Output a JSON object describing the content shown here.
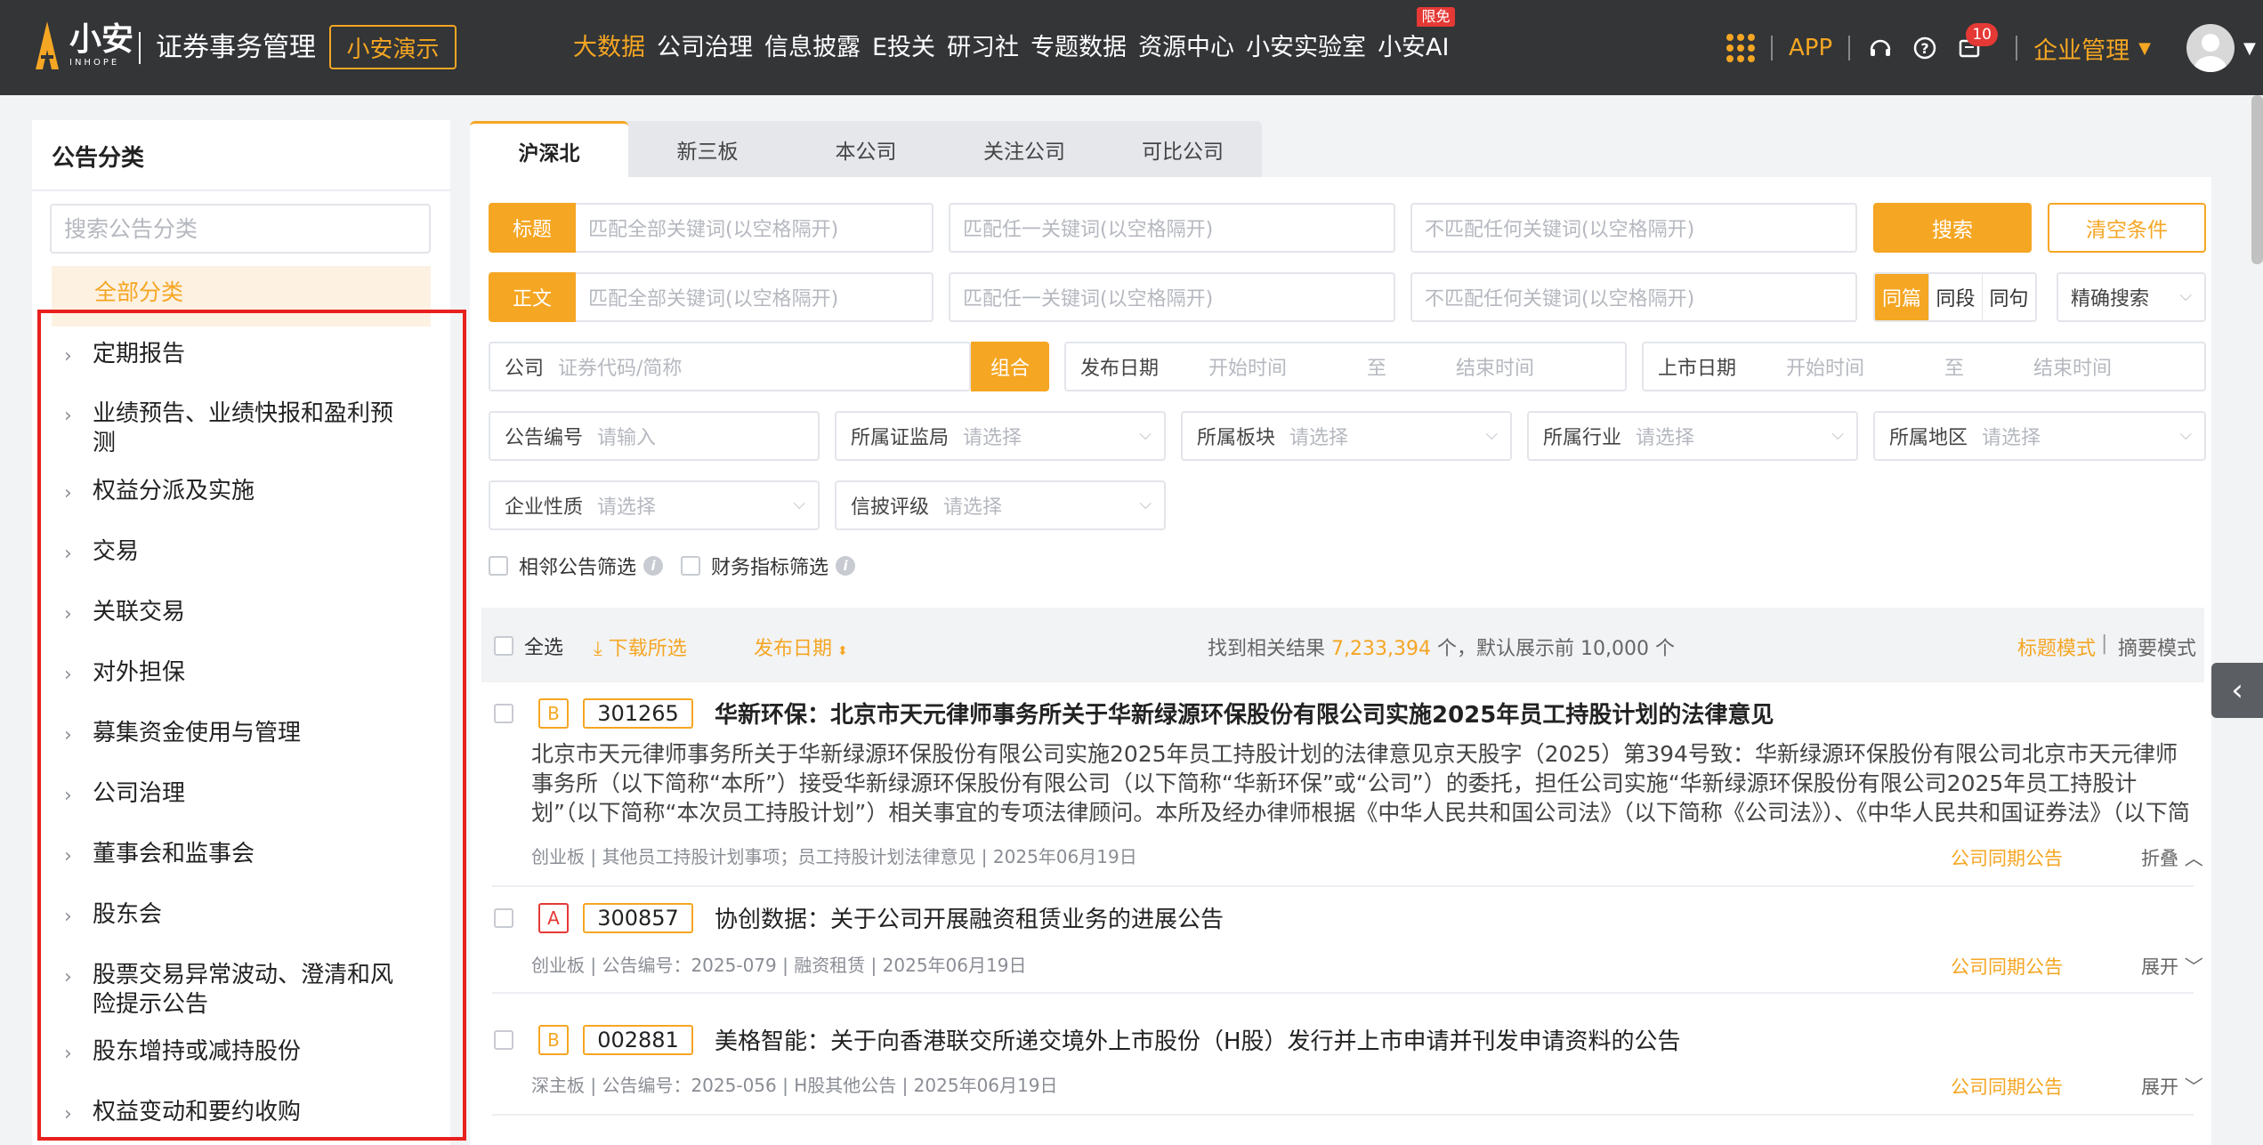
{
  "header": {
    "logo_cn": "小安",
    "logo_en": "INHOPE",
    "system_title": "证券事务管理",
    "demo_button": "小安演示",
    "nav": [
      {
        "label": "大数据",
        "active": true
      },
      {
        "label": "公司治理"
      },
      {
        "label": "信息披露"
      },
      {
        "label": "E投关"
      },
      {
        "label": "研习社"
      },
      {
        "label": "专题数据"
      },
      {
        "label": "资源中心"
      },
      {
        "label": "小安实验室"
      },
      {
        "label": "小安AI",
        "badge": "限免"
      }
    ],
    "app_link": "APP",
    "notification_count": "10",
    "org_menu": "企业管理",
    "accent_color": "#f5a623",
    "bg_color": "#333537"
  },
  "sidebar": {
    "title": "公告分类",
    "search_placeholder": "搜索公告分类",
    "all_label": "全部分类",
    "categories": [
      "定期报告",
      "业绩预告、业绩快报和盈利预测",
      "权益分派及实施",
      "交易",
      "关联交易",
      "对外担保",
      "募集资金使用与管理",
      "公司治理",
      "董事会和监事会",
      "股东会",
      "股票交易异常波动、澄清和风险提示公告",
      "股东增持或减持股份",
      "权益变动和要约收购"
    ]
  },
  "tabs": [
    "沪深北",
    "新三板",
    "本公司",
    "关注公司",
    "可比公司"
  ],
  "search": {
    "title_tag": "标题",
    "body_tag": "正文",
    "match_all_ph": "匹配全部关键词(以空格隔开)",
    "match_any_ph": "匹配任一关键词(以空格隔开)",
    "match_none_ph": "不匹配任何关键词(以空格隔开)",
    "search_btn": "搜索",
    "clear_btn": "清空条件",
    "scope": [
      "同篇",
      "同段",
      "同句"
    ],
    "precise": "精确搜索",
    "company_label": "公司",
    "company_ph": "证券代码/简称",
    "combo_btn": "组合",
    "publish_date_label": "发布日期",
    "start_ph": "开始时间",
    "to": "至",
    "end_ph": "结束时间",
    "listing_date_label": "上市日期",
    "ann_no_label": "公告编号",
    "ann_no_ph": "请输入",
    "csrc_label": "所属证监局",
    "board_label": "所属板块",
    "industry_label": "所属行业",
    "region_label": "所属地区",
    "nature_label": "企业性质",
    "rating_label": "信披评级",
    "select_ph": "请选择",
    "adjacent_filter": "相邻公告筛选",
    "finance_filter": "财务指标筛选"
  },
  "results": {
    "select_all": "全选",
    "download": "下载所选",
    "sort_by": "发布日期",
    "count_prefix": "找到相关结果",
    "count": "7,233,394",
    "count_suffix": "个，默认展示前 10,000 个",
    "mode_title": "标题模式",
    "mode_sep": "|",
    "mode_abstract": "摘要模式",
    "items": [
      {
        "grade": "B",
        "code": "301265",
        "title": "华新环保：北京市天元律师事务所关于华新绿源环保股份有限公司实施2025年员工持股计划的法律意见",
        "abstract": "北京市天元律师事务所关于华新绿源环保股份有限公司实施2025年员工持股计划的法律意见京天股字（2025）第394号致：华新绿源环保股份有限公司北京市天元律师事务所（以下简称“本所”）接受华新绿源环保股份有限公司（以下简称“华新环保”或“公司”）的委托，担任公司实施“华新绿源环保股份有限公司2025年员工持股计划”（以下简称“本次员工持股计划”）相关事宜的专项法律顾问。本所及经办律师根据《中华人民共和国公司法》（以下简称《公司法》）、《中华人民共和国证券法》（以下简称...",
        "meta": "创业板 | 其他员工持股计划事项；员工持股计划法律意见 | 2025年06月19日",
        "link": "公司同期公告",
        "fold": "折叠"
      },
      {
        "grade": "A",
        "code": "300857",
        "title": "协创数据：关于公司开展融资租赁业务的进展公告",
        "meta": "创业板 | 公告编号：2025-079 | 融资租赁 | 2025年06月19日",
        "link": "公司同期公告",
        "fold": "展开"
      },
      {
        "grade": "B",
        "code": "002881",
        "title": "美格智能：关于向香港联交所递交境外上市股份（H股）发行并上市申请并刊发申请资料的公告",
        "meta": "深主板 | 公告编号：2025-056 | H股其他公告 | 2025年06月19日",
        "link": "公司同期公告",
        "fold": "展开"
      }
    ]
  }
}
